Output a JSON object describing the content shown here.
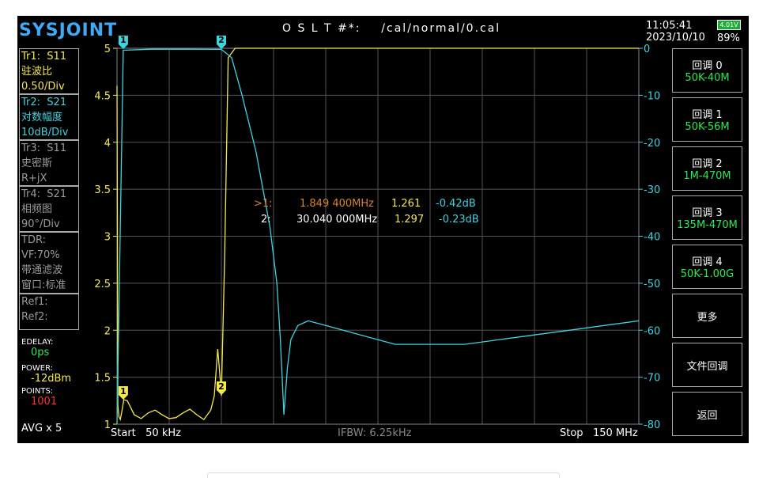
{
  "brand": "SYSJOINT",
  "title": "O S L T #*:    /cal/normal/0.cal",
  "time": "11:05:41",
  "date": "2023/10/10",
  "battery_voltage": "4.01V",
  "battery_pct": "89%",
  "traces": [
    {
      "id": "Tr1:",
      "param": "S11",
      "format": "驻波比",
      "scale": "0.50/Div",
      "color": "#f5e94a"
    },
    {
      "id": "Tr2:",
      "param": "S21",
      "format": "对数幅度",
      "scale": "10dB/Div",
      "color": "#3fd3df"
    },
    {
      "id": "Tr3:",
      "param": "S11",
      "format": "史密斯",
      "scale": "R+jX",
      "color": "#9a9a9a"
    },
    {
      "id": "Tr4:",
      "param": "S21",
      "format": "相频图",
      "scale": "90°/Div",
      "color": "#9a9a9a"
    }
  ],
  "tdr": {
    "label": "TDR:",
    "vf": "VF:70%",
    "mode": "带通滤波",
    "window": "窗口:标准"
  },
  "refs": [
    "Ref1:",
    "Ref2:"
  ],
  "edelay": {
    "label": "EDELAY:",
    "value": "0ps"
  },
  "power": {
    "label": "POWER:",
    "value": "-12dBm"
  },
  "points": {
    "label": "POINTS:",
    "value": "1001"
  },
  "avg": "AVG x 5",
  "start_label": "Start   50 kHz",
  "ifbw": "IFBW: 6.25kHz",
  "stop_label": "Stop   150 MHz",
  "markers": [
    {
      "tag": ">1:",
      "freq": "1.849 400MHz",
      "vswr": "1.261",
      "db": "-0.42dB",
      "color": "#d9822b"
    },
    {
      "tag": "2:",
      "freq": "30.040 000MHz",
      "vswr": "1.297",
      "db": "-0.23dB",
      "color": "#ffffff"
    }
  ],
  "buttons": [
    {
      "label": "回调 0",
      "sub": "50K-40M"
    },
    {
      "label": "回调 1",
      "sub": "50K-56M"
    },
    {
      "label": "回调 2",
      "sub": "1M-470M"
    },
    {
      "label": "回调 3",
      "sub": "135M-470M"
    },
    {
      "label": "回调 4",
      "sub": "50K-1.00G"
    },
    {
      "label": "更多",
      "sub": ""
    },
    {
      "label": "文件回调",
      "sub": ""
    },
    {
      "label": "返回",
      "sub": ""
    }
  ],
  "chart_data": {
    "type": "line",
    "x_range": [
      "50 kHz",
      "150 MHz"
    ],
    "left_axis": {
      "ticks": [
        "5",
        "4.5",
        "4",
        "3.5",
        "3",
        "2.5",
        "2",
        "1.5",
        "1"
      ],
      "ylim": [
        1,
        5
      ],
      "color": "#f5e94a"
    },
    "right_axis": {
      "ticks": [
        "0",
        "-10",
        "-20",
        "-30",
        "-40",
        "-50",
        "-60",
        "-70",
        "-80"
      ],
      "ylim": [
        -80,
        0
      ],
      "color": "#3fd3df"
    },
    "series": [
      {
        "name": "S11",
        "color": "#f5e94a",
        "x_mhz": [
          0.05,
          0.3,
          0.6,
          1.0,
          1.5,
          2.0,
          3.0,
          5,
          7,
          9,
          11,
          13,
          15,
          17,
          19,
          21,
          23,
          25,
          27,
          28,
          29,
          30,
          30.04,
          31,
          32,
          34,
          36,
          38,
          40,
          50,
          60,
          80,
          100,
          120,
          150
        ],
        "values": [
          4.6,
          1.2,
          1.08,
          1.05,
          1.15,
          1.26,
          1.25,
          1.1,
          1.06,
          1.12,
          1.15,
          1.1,
          1.06,
          1.07,
          1.12,
          1.16,
          1.1,
          1.05,
          1.15,
          1.3,
          1.8,
          1.35,
          1.3,
          2.8,
          4.9,
          5,
          5,
          5,
          5,
          5,
          5,
          5,
          5,
          5,
          5
        ]
      },
      {
        "name": "S21",
        "color": "#3fd3df",
        "x_mhz": [
          0.05,
          1.849,
          10,
          20,
          30.04,
          33,
          36,
          40,
          44,
          46,
          47,
          48,
          49,
          50,
          52,
          55,
          60,
          70,
          80,
          90,
          100,
          110,
          120,
          130,
          140,
          150
        ],
        "values": [
          -80,
          -0.42,
          -0.2,
          -0.2,
          -0.23,
          -2,
          -10,
          -22,
          -38,
          -50,
          -62,
          -78,
          -68,
          -62,
          -59,
          -58,
          -59,
          -61,
          -63,
          -63,
          -63,
          -62,
          -61,
          -60,
          -59,
          -58
        ]
      }
    ],
    "marker_positions_mhz": [
      1.849,
      30.04
    ]
  }
}
